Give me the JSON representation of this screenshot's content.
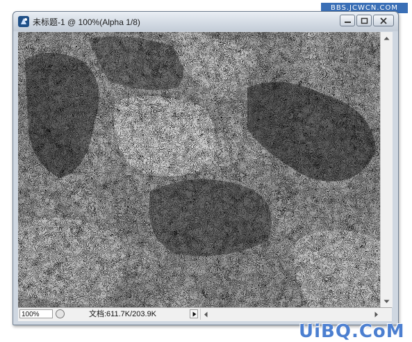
{
  "watermark_top": "BBS.JCWCN.COM",
  "watermark_bottom": "UiBQ.CoM",
  "window": {
    "title": "未标题-1 @ 100%(Alpha 1/8)",
    "controls": {
      "minimize_icon": "minimize-icon",
      "maximize_icon": "maximize-icon",
      "close_icon": "close-icon"
    }
  },
  "canvas": {
    "description_icon": "stone-texture-image"
  },
  "status": {
    "zoom": "100%",
    "doc_info": "文档:611.7K/203.9K"
  },
  "colors": {
    "titlebar": "#c3ccd7",
    "watermark_blue": "#4c7fd0",
    "watermark_top_bg": "#3a6fb6"
  }
}
